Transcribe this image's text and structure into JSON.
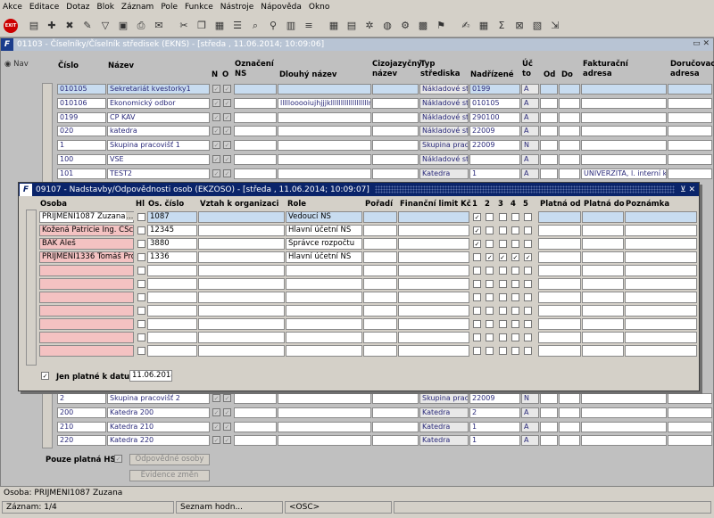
{
  "menu": [
    "Akce",
    "Editace",
    "Dotaz",
    "Blok",
    "Záznam",
    "Pole",
    "Funkce",
    "Nástroje",
    "Nápověda",
    "Okno"
  ],
  "toolbar": {
    "exit_label": "EXIT"
  },
  "main": {
    "title": "01103 - Číselníky/Číselník středisek (EKNS) - [středa , 11.06.2014; 10:09:06]",
    "nav_label": "Nav",
    "headers": {
      "cislo": "Číslo",
      "nazev": "Název",
      "n": "N",
      "o": "O",
      "oznaceni": "Označení",
      "ns": "NS",
      "dlouhy": "Dlouhý název",
      "cizo": "Cizojazyčný",
      "cizo2": "název",
      "typ": "Typ",
      "typ2": "střediska",
      "nadrizene": "Nadřízené",
      "uc": "Úč",
      "uc2": "to",
      "od": "Od",
      "do": "Do",
      "fakt": "Fakturační",
      "fakt2": "adresa",
      "doruc": "Doručovací",
      "doruc2": "adresa"
    },
    "rows_top": [
      {
        "cislo": "010105",
        "nazev": "Sekretariát kvestorky1",
        "dlouhy": "",
        "typ": "Nákladové stř",
        "nadr": "0199",
        "uc": "A",
        "fakt": ""
      },
      {
        "cislo": "010106",
        "nazev": "Ekonomický odbor",
        "dlouhy": "lllllooooiujhjjjklllllllllllllllllllm,m",
        "typ": "Nákladové stř",
        "nadr": "010105",
        "uc": "A",
        "fakt": ""
      },
      {
        "cislo": "0199",
        "nazev": "CP KAV",
        "dlouhy": "",
        "typ": "Nákladové stř",
        "nadr": "290100",
        "uc": "A",
        "fakt": ""
      },
      {
        "cislo": "020",
        "nazev": "katedra",
        "dlouhy": "",
        "typ": "Nákladové stř",
        "nadr": "22009",
        "uc": "A",
        "fakt": ""
      },
      {
        "cislo": "1",
        "nazev": "Skupina pracovišť 1",
        "dlouhy": "",
        "typ": "Skupina praco",
        "nadr": "22009",
        "uc": "N",
        "fakt": ""
      },
      {
        "cislo": "100",
        "nazev": "VSE",
        "dlouhy": "",
        "typ": "Nákladové stř",
        "nadr": "",
        "uc": "A",
        "fakt": ""
      },
      {
        "cislo": "101",
        "nazev": "TEST2",
        "dlouhy": "",
        "typ": "Katedra",
        "nadr": "1",
        "uc": "A",
        "fakt": "UNIVERZITA, l. interní kli"
      }
    ],
    "rows_bottom": [
      {
        "cislo": "2",
        "nazev": "Skupina pracovišť 2",
        "typ": "Skupina praco",
        "nadr": "22009",
        "uc": "N"
      },
      {
        "cislo": "200",
        "nazev": "Katedra 200",
        "typ": "Katedra",
        "nadr": "2",
        "uc": "A"
      },
      {
        "cislo": "210",
        "nazev": "Katedra 210",
        "typ": "Katedra",
        "nadr": "1",
        "uc": "A"
      },
      {
        "cislo": "220",
        "nazev": "Katedra 220",
        "typ": "Katedra",
        "nadr": "1",
        "uc": "A"
      }
    ],
    "pouze_label": "Pouze platná HS",
    "btn_odpovedne": "Odpovědné osoby",
    "btn_evidence": "Evidence změn"
  },
  "dialog": {
    "title": "09107 - Nadstavby/Odpovědnosti osob (EKZOSO) - [středa , 11.06.2014; 10:09:07]",
    "headers": {
      "osoba": "Osoba",
      "hl": "Hl",
      "os_cislo": "Os. číslo",
      "vztah": "Vztah k organizaci",
      "role": "Role",
      "poradi": "Pořadí",
      "limit": "Finanční limit Kč",
      "c1": "1",
      "c2": "2",
      "c3": "3",
      "c4": "4",
      "c5": "5",
      "platna_od": "Platná od",
      "platna_do": "Platná do",
      "poznamka": "Poznámka"
    },
    "rows": [
      {
        "osoba": "PRIJMENI1087 Zuzana",
        "os": "1087",
        "role": "Vedoucí NS",
        "checks": [
          true,
          false,
          false,
          false,
          false
        ]
      },
      {
        "osoba": "Kožená Patricie Ing. CSc.",
        "os": "12345",
        "role": "Hlavní účetní NS",
        "checks": [
          true,
          false,
          false,
          false,
          false
        ]
      },
      {
        "osoba": "BAK Aleš",
        "os": "3880",
        "role": "Správce rozpočtu",
        "checks": [
          true,
          false,
          false,
          false,
          false
        ]
      },
      {
        "osoba": "PRIJMENI1336 Tomáš Prof.",
        "os": "1336",
        "role": "Hlavní účetní NS",
        "checks": [
          false,
          true,
          true,
          true,
          true
        ]
      }
    ],
    "jen_label": "Jen platné k datu",
    "jen_value": "11.06.2014",
    "ellipsis": "..."
  },
  "status": {
    "line1": "Osoba: PRIJMENI1087 Zuzana",
    "zaznam": "Záznam: 1/4",
    "seznam": "Seznam hodn...",
    "osc": "<OSC>"
  }
}
